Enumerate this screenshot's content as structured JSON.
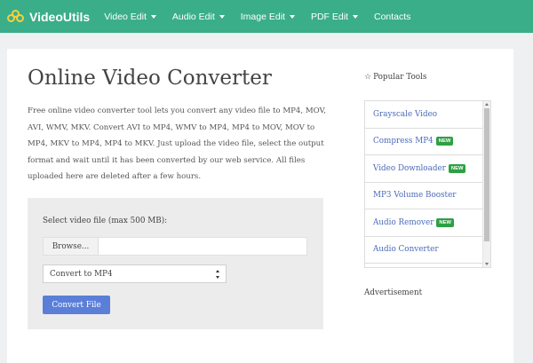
{
  "navbar": {
    "brand": "VideoUtils",
    "items": [
      {
        "label": "Video Edit",
        "dropdown": true
      },
      {
        "label": "Audio Edit",
        "dropdown": true
      },
      {
        "label": "Image Edit",
        "dropdown": true
      },
      {
        "label": "PDF Edit",
        "dropdown": true
      },
      {
        "label": "Contacts",
        "dropdown": false
      }
    ],
    "color": "#3aae88"
  },
  "main": {
    "title": "Online Video Converter",
    "intro": "Free online video converter tool lets you convert any video file to MP4, MOV, AVI, WMV, MKV. Convert AVI to MP4, WMV to MP4, MP4 to MOV, MOV to MP4, MKV to MP4, MP4 to MKV. Just upload the video file, select the output format and wait until it has been converted by our web service. All files uploaded here are deleted after a few hours.",
    "form": {
      "file_label": "Select video file (max 500 MB):",
      "browse_label": "Browse...",
      "file_name": "",
      "select_value": "Convert to MP4",
      "convert_label": "Convert File",
      "button_color": "#5b7fd8"
    }
  },
  "sidebar": {
    "popular_heading": "Popular Tools",
    "tools": [
      {
        "label": "Grayscale Video",
        "badge": ""
      },
      {
        "label": "Compress MP4",
        "badge": "NEW"
      },
      {
        "label": "Video Downloader",
        "badge": "NEW"
      },
      {
        "label": "MP3 Volume Booster",
        "badge": ""
      },
      {
        "label": "Audio Remover",
        "badge": "NEW"
      },
      {
        "label": "Audio Converter",
        "badge": ""
      }
    ],
    "badge_color": "#2ea043",
    "ad_heading": "Advertisement"
  }
}
